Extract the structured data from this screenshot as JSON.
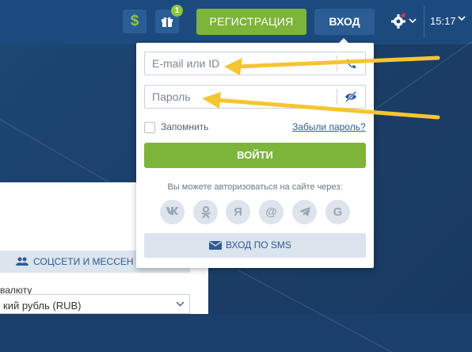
{
  "header": {
    "currency_icon": "$",
    "gift_badge": "1",
    "register_label": "РЕГИСТРАЦИЯ",
    "login_label": "ВХОД",
    "time": "15:17"
  },
  "login_popup": {
    "email_placeholder": "E-mail или ID",
    "password_placeholder": "Пароль",
    "remember_label": "Запомнить",
    "forgot_link": "Забыли пароль?",
    "submit_label": "ВОЙТИ",
    "social_hint": "Вы можете авторизоваться на сайте через:",
    "social_providers": [
      {
        "name": "vk",
        "glyph": "vk"
      },
      {
        "name": "odnoklassniki",
        "glyph": "ok"
      },
      {
        "name": "yandex",
        "glyph": "Я"
      },
      {
        "name": "mail",
        "glyph": "@"
      },
      {
        "name": "telegram",
        "glyph": "telegram"
      },
      {
        "name": "google",
        "glyph": "G"
      }
    ],
    "sms_label": "ВХОД ПО SMS"
  },
  "registration_panel": {
    "social_tab_label": "СОЦСЕТИ И МЕССЕН",
    "currency_label": "валюту",
    "currency_value": "кий рубль (RUB)"
  },
  "colors": {
    "header_bg": "#1c4a7e",
    "accent_green": "#7db43a",
    "accent_blue": "#2b5c94",
    "annotation_arrow": "#f5c531"
  }
}
